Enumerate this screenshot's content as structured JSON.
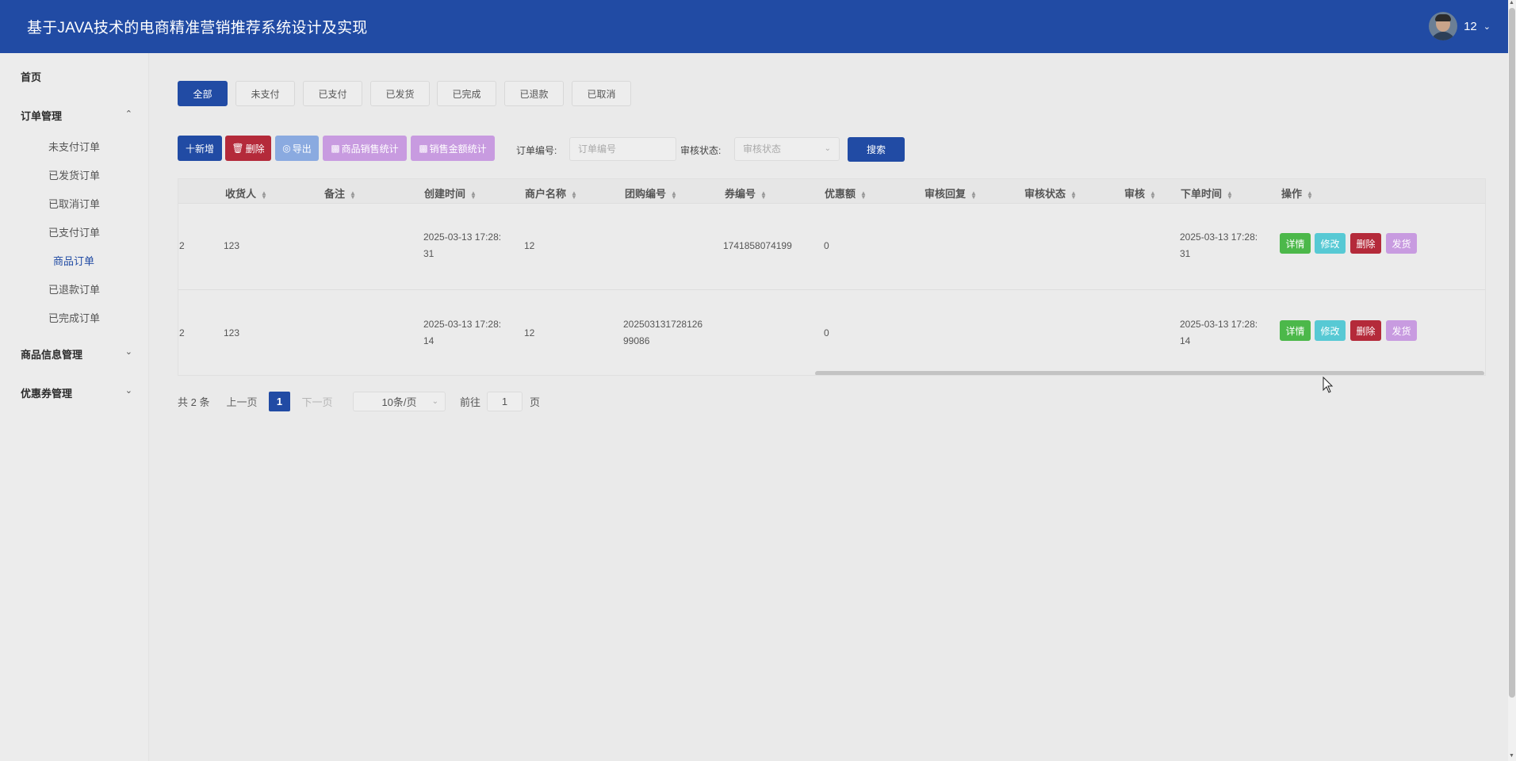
{
  "header": {
    "title": "基于JAVA技术的电商精准营销推荐系统设计及实现",
    "user": "12"
  },
  "sidebar": {
    "home": "首页",
    "order_mgmt": "订单管理",
    "order_items": [
      "未支付订单",
      "已发货订单",
      "已取消订单",
      "已支付订单",
      "商品订单",
      "已退款订单",
      "已完成订单"
    ],
    "goods_mgmt": "商品信息管理",
    "coupon_mgmt": "优惠券管理"
  },
  "tabs": [
    "全部",
    "未支付",
    "已支付",
    "已发货",
    "已完成",
    "已退款",
    "已取消"
  ],
  "toolbar": {
    "add": "十新增",
    "delete": "删除",
    "export": "导出",
    "goods_stats": "商品销售统计",
    "amount_stats": "销售金额统计",
    "order_no_label": "订单编号:",
    "order_no_placeholder": "订单编号",
    "audit_label": "审核状态:",
    "audit_placeholder": "审核状态",
    "search": "搜索"
  },
  "table": {
    "columns": [
      "收货人",
      "备注",
      "创建时间",
      "商户名称",
      "团购编号",
      "券编号",
      "优惠额",
      "审核回复",
      "审核状态",
      "审核",
      "下单时间",
      "操作"
    ],
    "rows": [
      {
        "first": "2",
        "receiver": "123",
        "remark": "",
        "created_1": "2025-03-13 17:28:",
        "created_2": "31",
        "merchant": "12",
        "group_1": "",
        "group_2": "",
        "coupon_no": "1741858074199",
        "discount": "0",
        "order_time_1": "2025-03-13 17:28:",
        "order_time_2": "31"
      },
      {
        "first": "2",
        "receiver": "123",
        "remark": "",
        "created_1": "2025-03-13 17:28:",
        "created_2": "14",
        "merchant": "12",
        "group_1": "202503131728126",
        "group_2": "99086",
        "coupon_no": "",
        "discount": "0",
        "order_time_1": "2025-03-13 17:28:",
        "order_time_2": "14"
      }
    ],
    "actions": {
      "detail": "详情",
      "edit": "修改",
      "delete": "删除",
      "ship": "发货"
    }
  },
  "pagination": {
    "total": "共 2 条",
    "prev": "上一页",
    "current": "1",
    "next": "下一页",
    "page_size": "10条/页",
    "goto_label": "前往",
    "goto_value": "1",
    "page_suffix": "页"
  },
  "colors": {
    "primary": "#214ba4",
    "danger": "#b42a3a",
    "success": "#4cb84a",
    "info": "#57c9d4",
    "purple": "#c89be0",
    "export": "#8aaae0"
  }
}
